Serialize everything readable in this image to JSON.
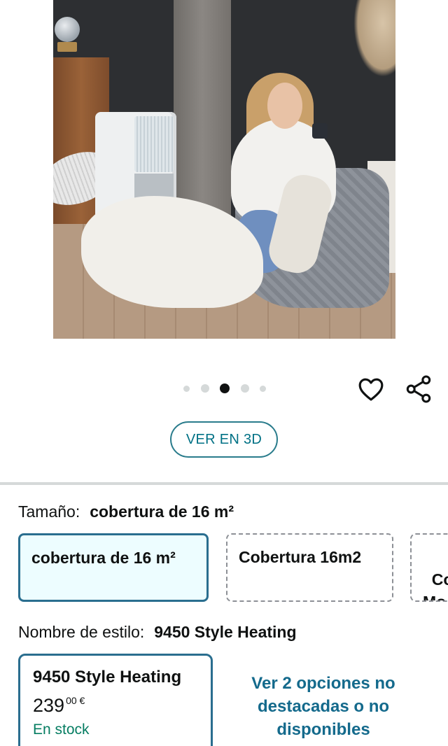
{
  "gallery": {
    "dots_count": 5,
    "active_dot": 3,
    "wishlist_icon": "heart-icon",
    "share_icon": "share-icon"
  },
  "view3d": {
    "label": "VER EN 3D"
  },
  "size": {
    "label": "Tamaño:",
    "selected_value": "cobertura de 16 m²",
    "options": [
      {
        "label": "cobertura de 16 m²",
        "selected": true
      },
      {
        "label": "Cobertura 16m2",
        "selected": false
      },
      {
        "label": "Col\nMo",
        "selected": false
      }
    ]
  },
  "style": {
    "label": "Nombre de estilo:",
    "selected_value": "9450 Style Heating",
    "card": {
      "name": "9450 Style Heating",
      "price_whole": "239",
      "price_fraction": "00 €",
      "availability": "En stock"
    },
    "more_options": "Ver 2 opciones no destacadas o no disponibles"
  },
  "colors": {
    "link": "#007185",
    "selected_border": "#2a6e8f",
    "selected_bg": "#edfdff",
    "in_stock": "#067d62"
  }
}
